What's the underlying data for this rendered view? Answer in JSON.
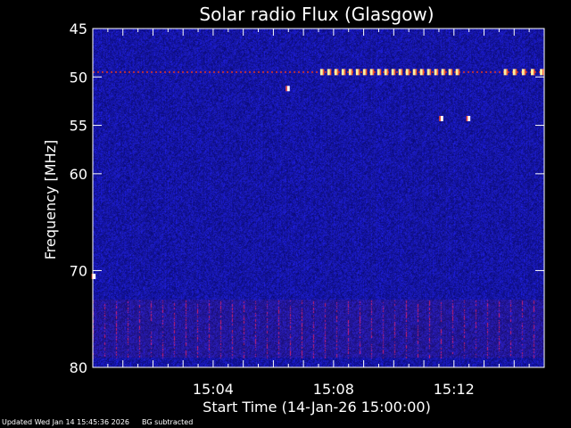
{
  "chart_data": {
    "type": "heatmap",
    "title": "Solar radio Flux (Glasgow)",
    "xlabel": "Start Time (14-Jan-26 15:00:00)",
    "ylabel": "Frequency [MHz]",
    "x_range_minutes": [
      0,
      15
    ],
    "x_ticks": [
      {
        "minute": 4,
        "label": "15:04"
      },
      {
        "minute": 8,
        "label": "15:08"
      },
      {
        "minute": 12,
        "label": "15:12"
      }
    ],
    "ylim": [
      45,
      80
    ],
    "y_inverted": true,
    "y_ticks": [
      {
        "value": 45,
        "label": "45"
      },
      {
        "value": 50,
        "label": "50"
      },
      {
        "value": 55,
        "label": "55"
      },
      {
        "value": 60,
        "label": "60"
      },
      {
        "value": 70,
        "label": "70"
      },
      {
        "value": 80,
        "label": "80"
      }
    ],
    "colors": {
      "background": "#000000",
      "spectrogram_base": "#1a1ab4",
      "interference": "#c83232",
      "burst": "#fff0a0"
    },
    "features": [
      {
        "type": "interference_line",
        "freq_mhz": 49.5,
        "minute_start": 0,
        "minute_end": 15
      },
      {
        "type": "interference_band",
        "freq_mhz_start": 73,
        "freq_mhz_end": 79,
        "minute_start": 0,
        "minute_end": 15
      },
      {
        "type": "burst_dots",
        "freq_mhz": 49.5,
        "minute_start": 7.6,
        "minute_end": 12.1,
        "count": 20
      },
      {
        "type": "burst_dots",
        "freq_mhz": 49.5,
        "minute_start": 13.7,
        "minute_end": 14.9,
        "count": 5
      },
      {
        "type": "spot",
        "freq_mhz": 51.2,
        "minute": 6.5
      },
      {
        "type": "spot",
        "freq_mhz": 54.3,
        "minute": 11.6
      },
      {
        "type": "spot",
        "freq_mhz": 54.3,
        "minute": 12.5
      },
      {
        "type": "spot",
        "freq_mhz": 70.6,
        "minute": 0.05
      }
    ]
  },
  "footer": {
    "updated": "Updated Wed Jan 14 15:45:36 2026",
    "note": "BG subtracted"
  }
}
